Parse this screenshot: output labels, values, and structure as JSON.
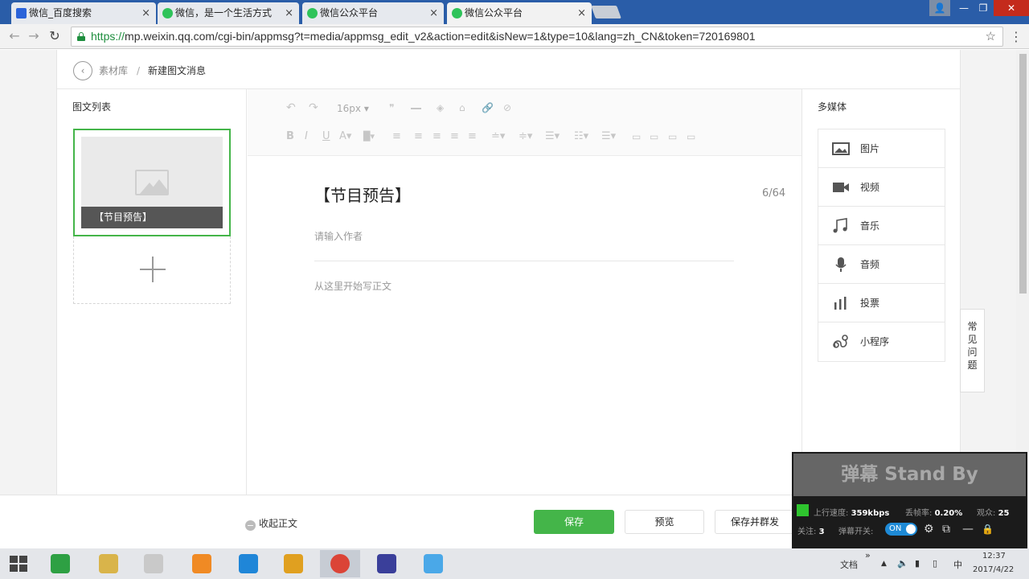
{
  "browser": {
    "tabs": [
      {
        "title": "微信_百度搜索",
        "icon": "baidu-paw-icon",
        "active": false
      },
      {
        "title": "微信，是一个生活方式",
        "icon": "wechat-icon",
        "active": false
      },
      {
        "title": "微信公众平台",
        "icon": "wechat-icon",
        "active": false
      },
      {
        "title": "微信公众平台",
        "icon": "wechat-icon",
        "active": true
      }
    ],
    "tab_close": "×",
    "url_scheme": "https://",
    "url_rest": "mp.weixin.qq.com/cgi-bin/appmsg?t=media/appmsg_edit_v2&action=edit&isNew=1&type=10&lang=zh_CN&token=720169801",
    "back": "←",
    "forward": "→",
    "reload": "↻",
    "star": "☆",
    "menu": "⋮",
    "win_user": "👤",
    "win_min": "—",
    "win_max": "❐",
    "win_close": "✕"
  },
  "breadcrumb": {
    "back": "‹",
    "library": "素材库",
    "separator": "/",
    "current": "新建图文消息"
  },
  "article_list": {
    "title": "图文列表",
    "items": [
      {
        "caption": "【节目预告】"
      }
    ],
    "add_symbol": "+"
  },
  "toolbar": {
    "font_size": "16px",
    "font_size_arrow": "▾",
    "undo": "↶",
    "redo": "↷",
    "quote": "❞",
    "link": "🔗",
    "bold": "B",
    "italic": "I",
    "underline": "U",
    "font_color": "A",
    "bg_color": "█",
    "dropdown_caret": "▾"
  },
  "editor": {
    "title": "【节目预告】",
    "title_count": "6/64",
    "author_placeholder": "请输入作者",
    "body_placeholder": "从这里开始写正文"
  },
  "media": {
    "title": "多媒体",
    "items": [
      {
        "label": "图片",
        "icon": "image-icon"
      },
      {
        "label": "视频",
        "icon": "video-camera-icon"
      },
      {
        "label": "音乐",
        "icon": "music-note-icon"
      },
      {
        "label": "音频",
        "icon": "microphone-icon"
      },
      {
        "label": "投票",
        "icon": "bar-chart-icon"
      },
      {
        "label": "小程序",
        "icon": "mini-program-icon"
      }
    ]
  },
  "faq": {
    "lines": [
      "常",
      "见",
      "问",
      "题"
    ]
  },
  "actions": {
    "collapse": "收起正文",
    "collapse_icon": "−",
    "save": "保存",
    "preview": "预览",
    "publish": "保存并群发"
  },
  "danmaku": {
    "header": "弹幕 Stand By",
    "upload_label": "上行速度:",
    "upload_value": "359kbps",
    "drop_label": "丢帧率:",
    "drop_value": "0.20%",
    "viewers_label": "观众:",
    "viewers_value": "25",
    "follow_label": "关注:",
    "follow_value": "3",
    "switch_label": "弹幕开关:",
    "switch_value": "ON",
    "settings": "⚙",
    "minimize": "—",
    "lock": "🔒"
  },
  "taskbar": {
    "tray_label": "文档",
    "tray_chevron": "»",
    "tray_up": "▲",
    "volume": "🔈",
    "network": "▮",
    "battery": "▯",
    "ime": "中",
    "time": "12:37",
    "date": "2017/4/22",
    "apps": [
      {
        "name": "store",
        "color": "#2ea043"
      },
      {
        "name": "file-explorer",
        "color": "#d9b44a"
      },
      {
        "name": "tools",
        "color": "#c9c9c9"
      },
      {
        "name": "uc-browser",
        "color": "#f08a24"
      },
      {
        "name": "bird-app",
        "color": "#1f86d8"
      },
      {
        "name": "search-app",
        "color": "#e0a020"
      },
      {
        "name": "chrome",
        "color": "#db4437"
      },
      {
        "name": "infinity-app",
        "color": "#3a3f9a"
      },
      {
        "name": "live-app",
        "color": "#4aa8e8"
      }
    ]
  },
  "colors": {
    "accent_green": "#44b549",
    "tab_strip": "#2a5da8",
    "danmaku_on": "#1e8ad6"
  }
}
